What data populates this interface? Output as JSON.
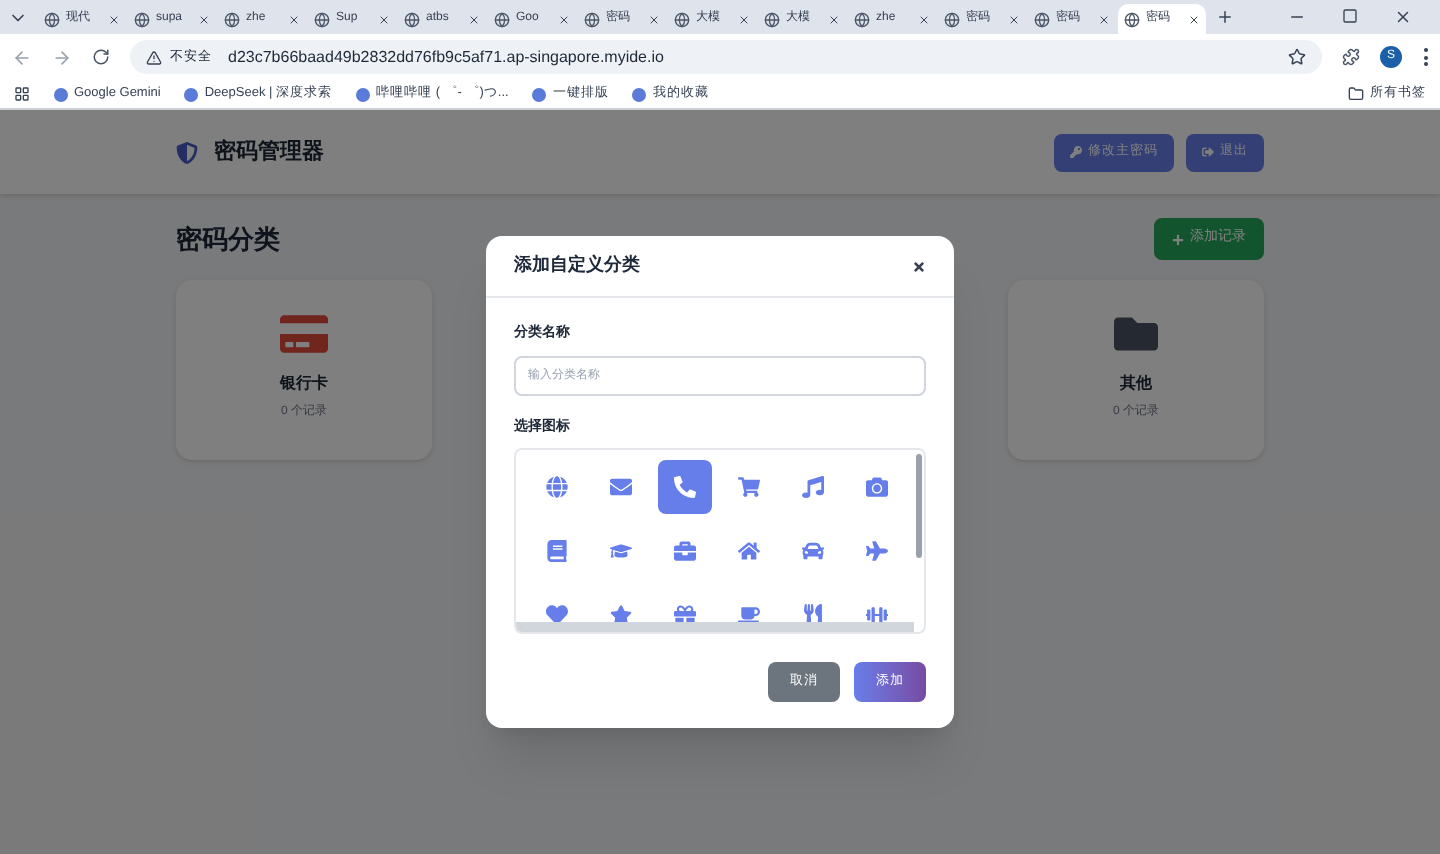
{
  "browser": {
    "tabs": [
      {
        "title": "现代",
        "selected": false
      },
      {
        "title": "supa",
        "selected": false
      },
      {
        "title": "zhe",
        "selected": false
      },
      {
        "title": "Sup",
        "selected": false
      },
      {
        "title": "atbs",
        "selected": false
      },
      {
        "title": "Goo",
        "selected": false
      },
      {
        "title": "密码",
        "selected": false
      },
      {
        "title": "大模",
        "selected": false
      },
      {
        "title": "大模",
        "selected": false
      },
      {
        "title": "zhe",
        "selected": false
      },
      {
        "title": "密码",
        "selected": false
      },
      {
        "title": "密码",
        "selected": false
      },
      {
        "title": "密码",
        "selected": true
      }
    ],
    "security": "不安全",
    "url": "d23c7b66baad49b2832dd76fb9c5af71.ap-singapore.myide.io",
    "profile": "S",
    "bookmarks": [
      "Google Gemini",
      "DeepSeek | 深度求索",
      "哔哩哔哩 ( ゜- ゜)つ...",
      "一键排版",
      "我的收藏"
    ],
    "all_bookmarks": "所有书签"
  },
  "app": {
    "title": "密码管理器",
    "buttons": [
      "修改主密码",
      "退出"
    ],
    "section_title": "密码分类",
    "add_button": "添加记录",
    "categories": [
      {
        "kind": "card",
        "name": "银行卡",
        "count": "0 个记录"
      },
      {
        "kind": "folder",
        "name": "其他",
        "count": "0 个记录"
      }
    ]
  },
  "dialog": {
    "title": "添加自定义分类",
    "name_label": "分类名称",
    "name_placeholder": "输入分类名称",
    "icon_label": "选择图标",
    "icons": [
      {
        "kind": "globe",
        "selected": false
      },
      {
        "kind": "envelope",
        "selected": false
      },
      {
        "kind": "phone",
        "selected": true
      },
      {
        "kind": "cart",
        "selected": false
      },
      {
        "kind": "music",
        "selected": false
      },
      {
        "kind": "camera",
        "selected": false
      },
      {
        "kind": "book",
        "selected": false
      },
      {
        "kind": "graduation",
        "selected": false
      },
      {
        "kind": "briefcase",
        "selected": false
      },
      {
        "kind": "home",
        "selected": false
      },
      {
        "kind": "car",
        "selected": false
      },
      {
        "kind": "plane",
        "selected": false
      },
      {
        "kind": "heart",
        "selected": false
      },
      {
        "kind": "star",
        "selected": false
      },
      {
        "kind": "gift",
        "selected": false
      },
      {
        "kind": "coffee",
        "selected": false
      },
      {
        "kind": "utensils",
        "selected": false
      },
      {
        "kind": "dumbbell",
        "selected": false
      }
    ],
    "cancel": "取消",
    "submit": "添加"
  }
}
